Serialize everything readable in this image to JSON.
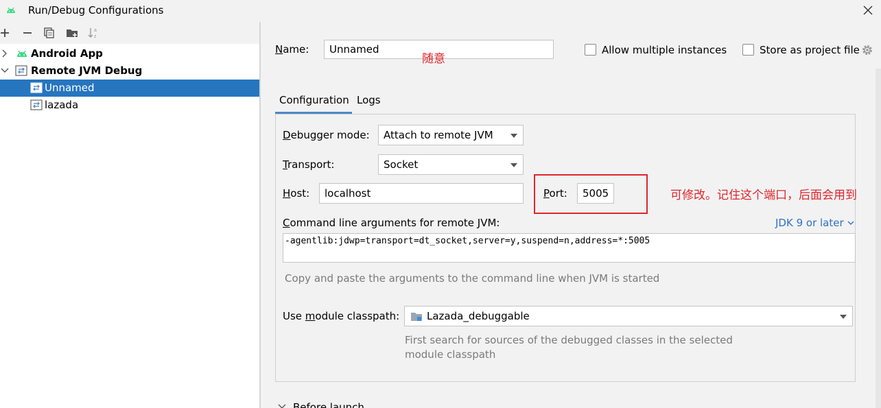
{
  "window": {
    "title": "Run/Debug Configurations"
  },
  "toolbar": {
    "buttons": [
      {
        "name": "add-icon"
      },
      {
        "name": "remove-icon"
      },
      {
        "name": "copy-icon"
      },
      {
        "name": "new-folder-icon"
      },
      {
        "name": "sort-icon"
      }
    ]
  },
  "tree": {
    "groups": [
      {
        "label": "Android App",
        "expanded": false,
        "icon": "android-icon"
      },
      {
        "label": "Remote JVM Debug",
        "expanded": true,
        "icon": "remote-debug-icon",
        "children": [
          {
            "label": "Unnamed",
            "selected": true
          },
          {
            "label": "lazada",
            "selected": false
          }
        ]
      }
    ]
  },
  "form": {
    "name_label": "Name:",
    "name_value": "Unnamed",
    "allow_multiple_label": "Allow multiple instances",
    "store_project_label": "Store as project file",
    "tabs": [
      "Configuration",
      "Logs"
    ],
    "active_tab": "Configuration",
    "debugger_mode_label": "Debugger mode:",
    "debugger_mode_value": "Attach to remote JVM",
    "transport_label": "Transport:",
    "transport_value": "Socket",
    "host_label": "Host:",
    "host_value": "localhost",
    "port_label": "Port:",
    "port_value": "5005",
    "cmd_label": "Command line arguments for remote JVM:",
    "jdk_link": "JDK 9 or later",
    "cmd_value": "-agentlib:jdwp=transport=dt_socket,server=y,suspend=n,address=*:5005",
    "cmd_hint": "Copy and paste the arguments to the command line when JVM is started",
    "module_label": "Use module classpath:",
    "module_value": "Lazada_debuggable",
    "module_hint_line1": "First search for sources of the debugged classes in the selected",
    "module_hint_line2": "module classpath",
    "before_launch": "Before launch"
  },
  "annotations": {
    "name_note": "随意",
    "port_note": "可修改。记住这个端口，后面会用到"
  },
  "colors": {
    "selection": "#2675bf",
    "tab_underline": "#4a88c7",
    "link": "#2f73c4",
    "annotation_red": "#e0252b",
    "android_green": "#3ddc84"
  }
}
